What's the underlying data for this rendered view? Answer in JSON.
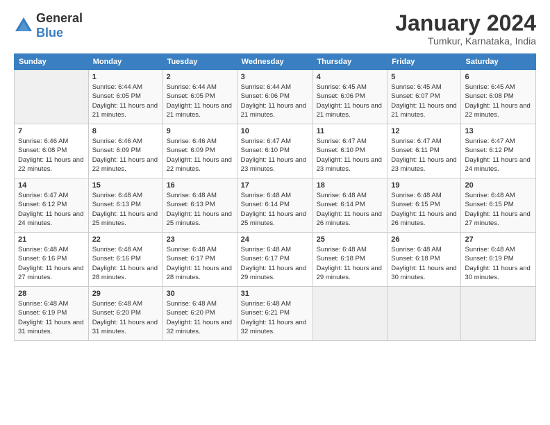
{
  "logo": {
    "text_general": "General",
    "text_blue": "Blue"
  },
  "title": "January 2024",
  "subtitle": "Tumkur, Karnataka, India",
  "header": {
    "days": [
      "Sunday",
      "Monday",
      "Tuesday",
      "Wednesday",
      "Thursday",
      "Friday",
      "Saturday"
    ]
  },
  "weeks": [
    [
      {
        "day": "",
        "empty": true
      },
      {
        "day": "1",
        "sunrise": "Sunrise: 6:44 AM",
        "sunset": "Sunset: 6:05 PM",
        "daylight": "Daylight: 11 hours and 21 minutes."
      },
      {
        "day": "2",
        "sunrise": "Sunrise: 6:44 AM",
        "sunset": "Sunset: 6:05 PM",
        "daylight": "Daylight: 11 hours and 21 minutes."
      },
      {
        "day": "3",
        "sunrise": "Sunrise: 6:44 AM",
        "sunset": "Sunset: 6:06 PM",
        "daylight": "Daylight: 11 hours and 21 minutes."
      },
      {
        "day": "4",
        "sunrise": "Sunrise: 6:45 AM",
        "sunset": "Sunset: 6:06 PM",
        "daylight": "Daylight: 11 hours and 21 minutes."
      },
      {
        "day": "5",
        "sunrise": "Sunrise: 6:45 AM",
        "sunset": "Sunset: 6:07 PM",
        "daylight": "Daylight: 11 hours and 21 minutes."
      },
      {
        "day": "6",
        "sunrise": "Sunrise: 6:45 AM",
        "sunset": "Sunset: 6:08 PM",
        "daylight": "Daylight: 11 hours and 22 minutes."
      }
    ],
    [
      {
        "day": "7",
        "sunrise": "Sunrise: 6:46 AM",
        "sunset": "Sunset: 6:08 PM",
        "daylight": "Daylight: 11 hours and 22 minutes."
      },
      {
        "day": "8",
        "sunrise": "Sunrise: 6:46 AM",
        "sunset": "Sunset: 6:09 PM",
        "daylight": "Daylight: 11 hours and 22 minutes."
      },
      {
        "day": "9",
        "sunrise": "Sunrise: 6:46 AM",
        "sunset": "Sunset: 6:09 PM",
        "daylight": "Daylight: 11 hours and 22 minutes."
      },
      {
        "day": "10",
        "sunrise": "Sunrise: 6:47 AM",
        "sunset": "Sunset: 6:10 PM",
        "daylight": "Daylight: 11 hours and 23 minutes."
      },
      {
        "day": "11",
        "sunrise": "Sunrise: 6:47 AM",
        "sunset": "Sunset: 6:10 PM",
        "daylight": "Daylight: 11 hours and 23 minutes."
      },
      {
        "day": "12",
        "sunrise": "Sunrise: 6:47 AM",
        "sunset": "Sunset: 6:11 PM",
        "daylight": "Daylight: 11 hours and 23 minutes."
      },
      {
        "day": "13",
        "sunrise": "Sunrise: 6:47 AM",
        "sunset": "Sunset: 6:12 PM",
        "daylight": "Daylight: 11 hours and 24 minutes."
      }
    ],
    [
      {
        "day": "14",
        "sunrise": "Sunrise: 6:47 AM",
        "sunset": "Sunset: 6:12 PM",
        "daylight": "Daylight: 11 hours and 24 minutes."
      },
      {
        "day": "15",
        "sunrise": "Sunrise: 6:48 AM",
        "sunset": "Sunset: 6:13 PM",
        "daylight": "Daylight: 11 hours and 25 minutes."
      },
      {
        "day": "16",
        "sunrise": "Sunrise: 6:48 AM",
        "sunset": "Sunset: 6:13 PM",
        "daylight": "Daylight: 11 hours and 25 minutes."
      },
      {
        "day": "17",
        "sunrise": "Sunrise: 6:48 AM",
        "sunset": "Sunset: 6:14 PM",
        "daylight": "Daylight: 11 hours and 25 minutes."
      },
      {
        "day": "18",
        "sunrise": "Sunrise: 6:48 AM",
        "sunset": "Sunset: 6:14 PM",
        "daylight": "Daylight: 11 hours and 26 minutes."
      },
      {
        "day": "19",
        "sunrise": "Sunrise: 6:48 AM",
        "sunset": "Sunset: 6:15 PM",
        "daylight": "Daylight: 11 hours and 26 minutes."
      },
      {
        "day": "20",
        "sunrise": "Sunrise: 6:48 AM",
        "sunset": "Sunset: 6:15 PM",
        "daylight": "Daylight: 11 hours and 27 minutes."
      }
    ],
    [
      {
        "day": "21",
        "sunrise": "Sunrise: 6:48 AM",
        "sunset": "Sunset: 6:16 PM",
        "daylight": "Daylight: 11 hours and 27 minutes."
      },
      {
        "day": "22",
        "sunrise": "Sunrise: 6:48 AM",
        "sunset": "Sunset: 6:16 PM",
        "daylight": "Daylight: 11 hours and 28 minutes."
      },
      {
        "day": "23",
        "sunrise": "Sunrise: 6:48 AM",
        "sunset": "Sunset: 6:17 PM",
        "daylight": "Daylight: 11 hours and 28 minutes."
      },
      {
        "day": "24",
        "sunrise": "Sunrise: 6:48 AM",
        "sunset": "Sunset: 6:17 PM",
        "daylight": "Daylight: 11 hours and 29 minutes."
      },
      {
        "day": "25",
        "sunrise": "Sunrise: 6:48 AM",
        "sunset": "Sunset: 6:18 PM",
        "daylight": "Daylight: 11 hours and 29 minutes."
      },
      {
        "day": "26",
        "sunrise": "Sunrise: 6:48 AM",
        "sunset": "Sunset: 6:18 PM",
        "daylight": "Daylight: 11 hours and 30 minutes."
      },
      {
        "day": "27",
        "sunrise": "Sunrise: 6:48 AM",
        "sunset": "Sunset: 6:19 PM",
        "daylight": "Daylight: 11 hours and 30 minutes."
      }
    ],
    [
      {
        "day": "28",
        "sunrise": "Sunrise: 6:48 AM",
        "sunset": "Sunset: 6:19 PM",
        "daylight": "Daylight: 11 hours and 31 minutes."
      },
      {
        "day": "29",
        "sunrise": "Sunrise: 6:48 AM",
        "sunset": "Sunset: 6:20 PM",
        "daylight": "Daylight: 11 hours and 31 minutes."
      },
      {
        "day": "30",
        "sunrise": "Sunrise: 6:48 AM",
        "sunset": "Sunset: 6:20 PM",
        "daylight": "Daylight: 11 hours and 32 minutes."
      },
      {
        "day": "31",
        "sunrise": "Sunrise: 6:48 AM",
        "sunset": "Sunset: 6:21 PM",
        "daylight": "Daylight: 11 hours and 32 minutes."
      },
      {
        "day": "",
        "empty": true
      },
      {
        "day": "",
        "empty": true
      },
      {
        "day": "",
        "empty": true
      }
    ]
  ]
}
